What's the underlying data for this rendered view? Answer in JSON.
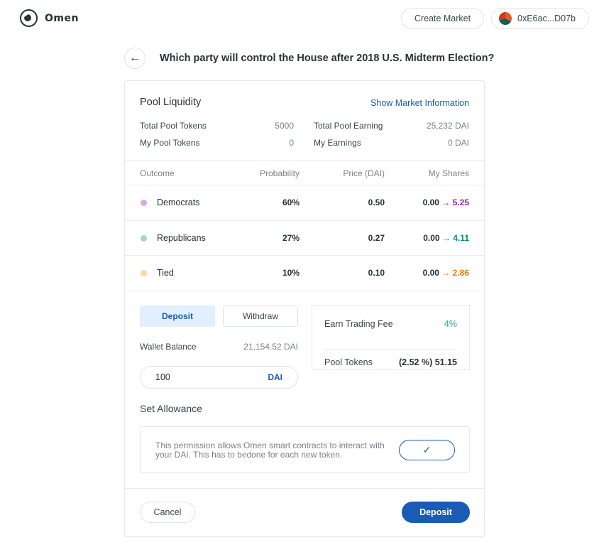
{
  "header": {
    "logo_text": "Omen",
    "create_market_label": "Create Market",
    "wallet_address": "0xE6ac...D07b"
  },
  "title": "Which party will control the House after 2018 U.S. Midterm Election?",
  "pool": {
    "heading": "Pool Liquidity",
    "show_info_link": "Show Market Information",
    "stats": {
      "total_pool_tokens_label": "Total Pool Tokens",
      "total_pool_tokens_value": "5000",
      "my_pool_tokens_label": "My Pool Tokens",
      "my_pool_tokens_value": "0",
      "total_pool_earning_label": "Total Pool Earning",
      "total_pool_earning_value": "25,232 DAI",
      "my_earnings_label": "My Earnings",
      "my_earnings_value": "0 DAI"
    }
  },
  "table": {
    "headers": [
      "Outcome",
      "Probability",
      "Price (DAI)",
      "My Shares"
    ],
    "rows": [
      {
        "name": "Democrats",
        "probability": "60%",
        "price": "0.50",
        "shares_from": "0.00",
        "arrow": "→",
        "shares_to": "5.25",
        "color": "#d9a8e3",
        "accent": "#8e24aa"
      },
      {
        "name": "Republicans",
        "probability": "27%",
        "price": "0.27",
        "shares_from": "0.00",
        "arrow": "→",
        "shares_to": "4.11",
        "color": "#9fd9cf",
        "accent": "#00897b"
      },
      {
        "name": "Tied",
        "probability": "10%",
        "price": "0.10",
        "shares_from": "0.00",
        "arrow": "→",
        "shares_to": "2.86",
        "color": "#ffd59e",
        "accent": "#f57c00"
      }
    ]
  },
  "form": {
    "tab_deposit": "Deposit",
    "tab_withdraw": "Withdraw",
    "wallet_balance_label": "Wallet Balance",
    "wallet_balance_value": "21,154.52 DAI",
    "amount_value": "100",
    "amount_unit": "DAI"
  },
  "fee_box": {
    "earn_fee_label": "Earn Trading Fee",
    "earn_fee_value": "4%",
    "pool_tokens_label": "Pool Tokens",
    "pool_tokens_value": "(2.52 %) 51.15"
  },
  "allowance": {
    "heading": "Set Allowance",
    "text": "This permission allows Omen smart contracts to interact with your DAI. This has to bedone for each new token.",
    "check_icon": "✓"
  },
  "footer": {
    "cancel_label": "Cancel",
    "deposit_label": "Deposit"
  },
  "colors": {
    "accent": "#1a5bb5",
    "accent_light": "#e1efff"
  }
}
